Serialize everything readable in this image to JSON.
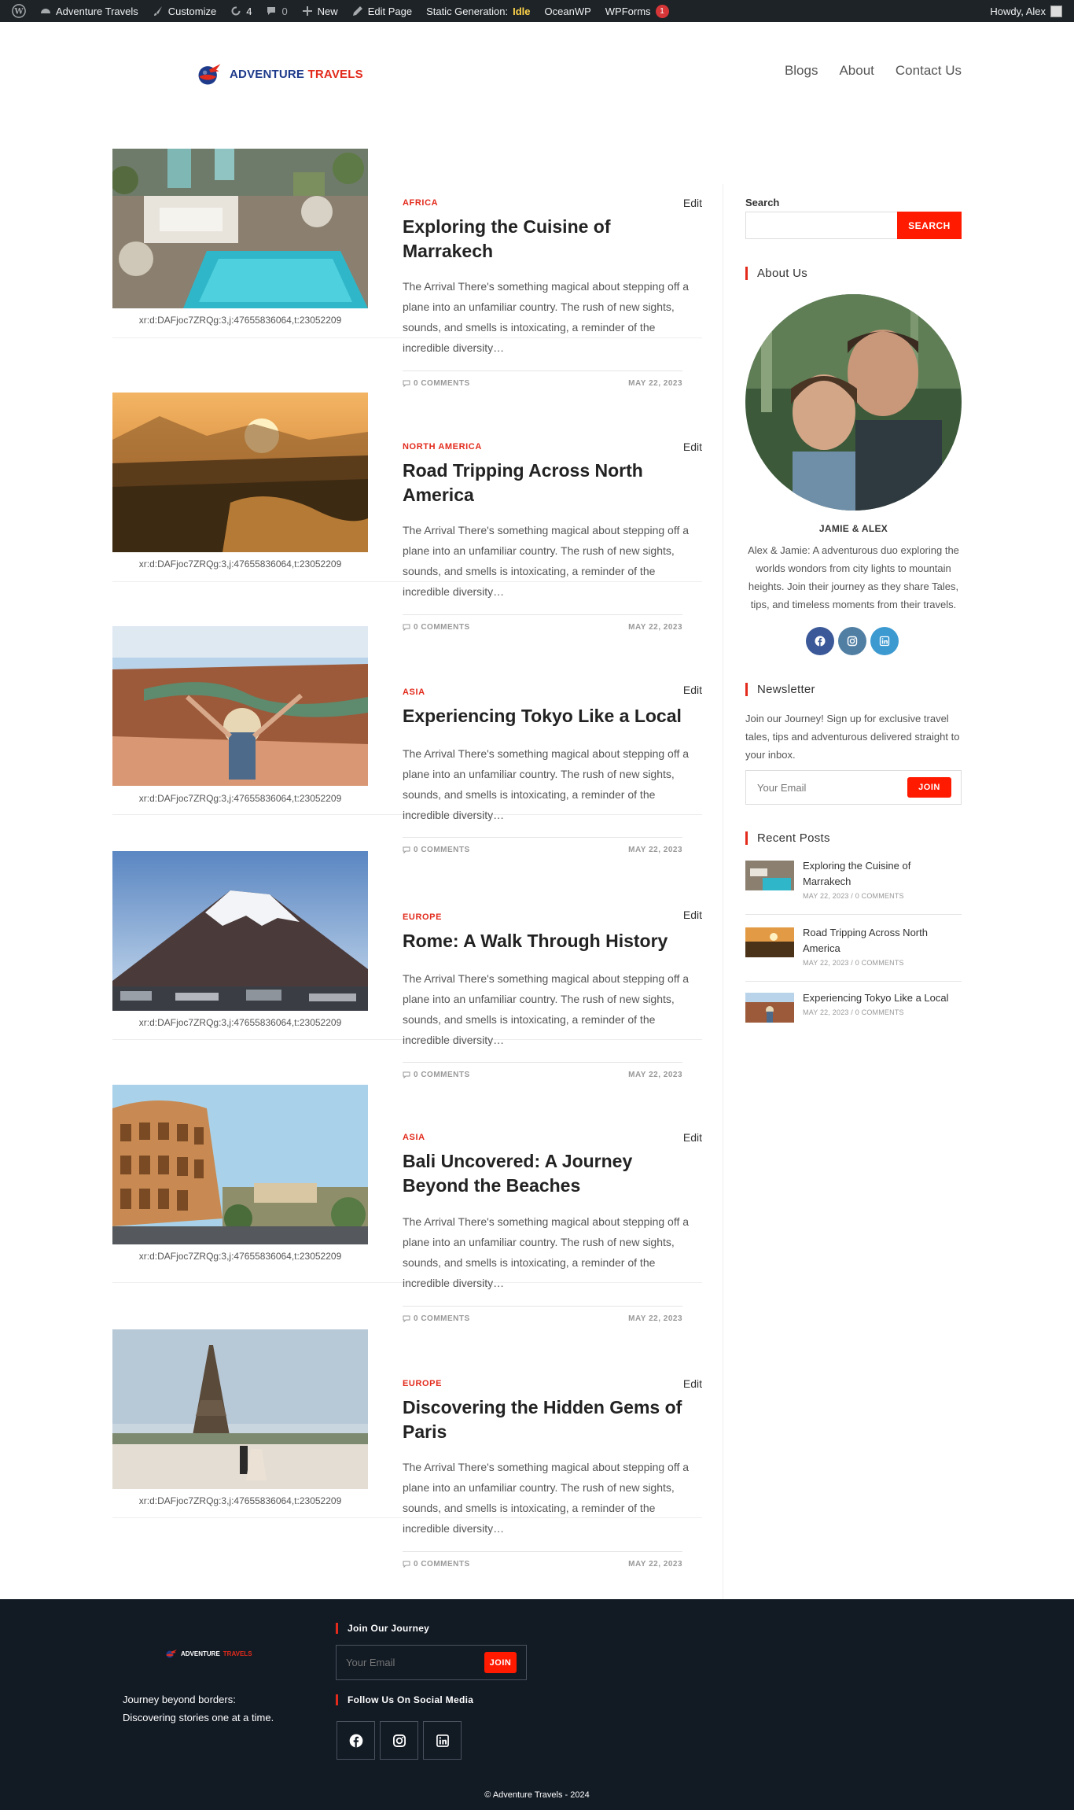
{
  "adminbar": {
    "site_name": "Adventure Travels",
    "customize": "Customize",
    "updates_count": "4",
    "comments_count": "0",
    "new": "New",
    "edit_page": "Edit Page",
    "static_gen_label": "Static Generation:",
    "static_gen_state": "Idle",
    "theme": "OceanWP",
    "wpforms": "WPForms",
    "wpforms_badge": "1",
    "howdy": "Howdy, Alex"
  },
  "header": {
    "logo_text_a": "ADVENTURE",
    "logo_text_b": "TRAVELS",
    "nav": [
      "Blogs",
      "About",
      "Contact Us"
    ]
  },
  "image_caption": "xr:d:DAFjoc7ZRQg:3,j:47655836064,t:23052209",
  "posts": [
    {
      "category": "AFRICA",
      "title": "Exploring the Cuisine of Marrakech",
      "excerpt": "The Arrival There's something magical about stepping off a plane into an unfamiliar country. The rush of new sights, sounds, and smells is intoxicating, a reminder of the incredible diversity…",
      "comments": "0 COMMENTS",
      "date": "MAY 22, 2023",
      "edit": "Edit"
    },
    {
      "category": "NORTH AMERICA",
      "title": "Road Tripping Across North America",
      "excerpt": "The Arrival There's something magical about stepping off a plane into an unfamiliar country. The rush of new sights, sounds, and smells is intoxicating, a reminder of the incredible diversity…",
      "comments": "0 COMMENTS",
      "date": "MAY 22, 2023",
      "edit": "Edit"
    },
    {
      "category": "ASIA",
      "title": "Experiencing Tokyo Like a Local",
      "excerpt": "The Arrival There's something magical about stepping off a plane into an unfamiliar country. The rush of new sights, sounds, and smells is intoxicating, a reminder of the incredible diversity…",
      "comments": "0 COMMENTS",
      "date": "MAY 22, 2023",
      "edit": "Edit"
    },
    {
      "category": "EUROPE",
      "title": "Rome: A Walk Through History",
      "excerpt": "The Arrival There's something magical about stepping off a plane into an unfamiliar country. The rush of new sights, sounds, and smells is intoxicating, a reminder of the incredible diversity…",
      "comments": "0 COMMENTS",
      "date": "MAY 22, 2023",
      "edit": "Edit"
    },
    {
      "category": "ASIA",
      "title": "Bali Uncovered: A Journey Beyond the Beaches",
      "excerpt": "The Arrival There's something magical about stepping off a plane into an unfamiliar country. The rush of new sights, sounds, and smells is intoxicating, a reminder of the incredible diversity…",
      "comments": "0 COMMENTS",
      "date": "MAY 22, 2023",
      "edit": "Edit"
    },
    {
      "category": "EUROPE",
      "title": "Discovering the Hidden Gems of Paris",
      "excerpt": "The Arrival There's something magical about stepping off a plane into an unfamiliar country. The rush of new sights, sounds, and smells is intoxicating, a reminder of the incredible diversity…",
      "comments": "0 COMMENTS",
      "date": "MAY 22, 2023",
      "edit": "Edit"
    }
  ],
  "sidebar": {
    "search_label": "Search",
    "search_button": "SEARCH",
    "about_title": "About Us",
    "about_name": "JAMIE & ALEX",
    "about_bio": "Alex & Jamie: A adventurous duo exploring the worlds wondors from city lights to mountain heights. Join their journey as they share Tales, tips, and timeless moments from their travels.",
    "newsletter_title": "Newsletter",
    "newsletter_text": "Join our Journey! Sign up for exclusive travel tales, tips and adventurous delivered straight to your inbox.",
    "newsletter_placeholder": "Your Email",
    "newsletter_button": "JOIN",
    "recent_title": "Recent Posts",
    "recent": [
      {
        "title": "Exploring the Cuisine of Marrakech",
        "date": "MAY 22, 2023",
        "comments": "0 COMMENTS"
      },
      {
        "title": "Road Tripping Across North America",
        "date": "MAY 22, 2023",
        "comments": "0 COMMENTS"
      },
      {
        "title": "Experiencing Tokyo Like a Local",
        "date": "MAY 22, 2023",
        "comments": "0 COMMENTS"
      }
    ]
  },
  "footer": {
    "logo_a": "ADVENTURE",
    "logo_b": "TRAVELS",
    "tagline_1": "Journey beyond borders:",
    "tagline_2": "Discovering stories one at a time.",
    "join_title": "Join Our Journey",
    "email_placeholder": "Your Email",
    "join_button": "JOIN",
    "follow_title": "Follow Us On Social Media",
    "copyright": "© Adventure Travels - 2024"
  },
  "colors": {
    "accent": "#e22b1c",
    "button": "#ff1a00",
    "adminbar_bg": "#1d2327",
    "footer_bg": "#121a24",
    "brand_blue": "#1e3a8a"
  }
}
